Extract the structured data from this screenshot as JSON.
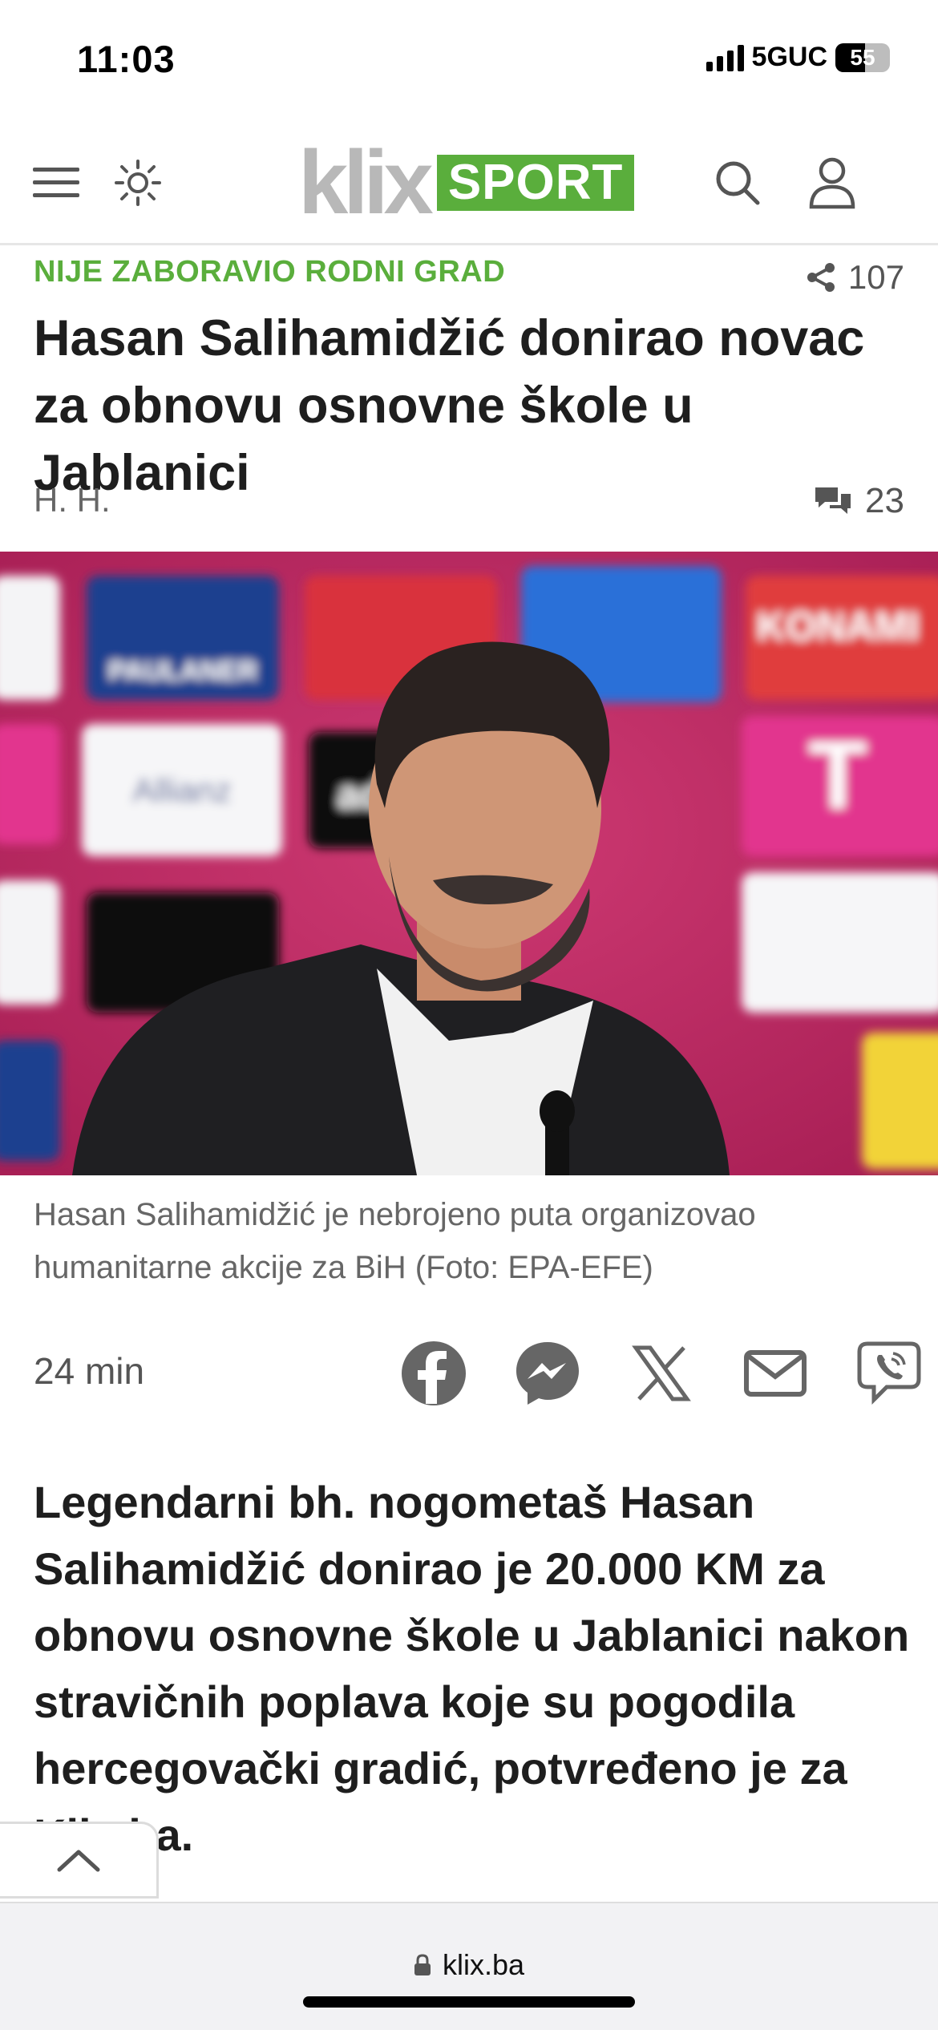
{
  "status": {
    "time": "11:03",
    "network": "5GUC",
    "battery": "55",
    "battery_level": 0.55
  },
  "header": {
    "logo_main": "klix",
    "logo_badge": "SPORT",
    "menu_icon": "hamburger-menu-icon",
    "theme_icon": "sun-icon",
    "search_icon": "search-icon",
    "account_icon": "user-icon"
  },
  "article": {
    "kicker": "NIJE ZABORAVIO RODNI GRAD",
    "share_count": "107",
    "title": "Hasan Salihamidžić donirao novac za obnovu osnovne škole u Jablanici",
    "author": "H. H.",
    "comment_count": "23",
    "caption": "Hasan Salihamidžić je nebrojeno puta organizovao humanitarne akcije za BiH (Foto: EPA-EFE)",
    "time_ago": "24 min",
    "lead": "Legendarni bh. nogometaš Hasan Salihamidžić donirao je 20.000 KM za obnovu osnovne škole u Jablanici nakon stravičnih poplava koje su pogodila hercegovački gradić, potvređeno je za Klix.ba."
  },
  "photo_backdrop": {
    "sponsors": [
      "PAULANER",
      "KONAMI",
      "Allianz",
      "adidas",
      "T"
    ]
  },
  "share_buttons": [
    "facebook-icon",
    "messenger-icon",
    "x-icon",
    "email-icon",
    "viber-icon"
  ],
  "browser": {
    "url": "klix.ba"
  },
  "colors": {
    "brand_green": "#5aae3c",
    "logo_gray": "#b8b8b8",
    "backdrop_magenta": "#c02a63"
  }
}
